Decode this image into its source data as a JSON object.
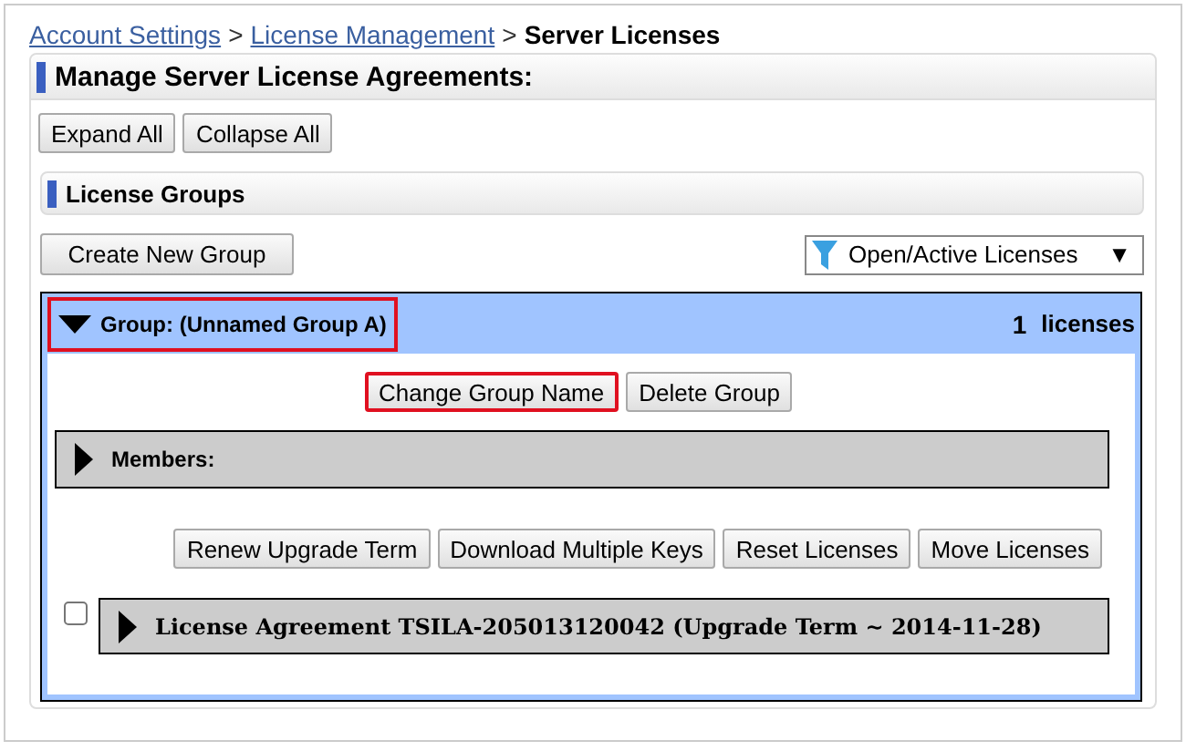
{
  "breadcrumb": {
    "links": [
      "Account Settings",
      "License Management"
    ],
    "separators": [
      ">",
      ">"
    ],
    "current": "Server Licenses"
  },
  "panel": {
    "title": "Manage Server License Agreements:",
    "buttons": [
      "Expand All",
      "Collapse All"
    ]
  },
  "license_groups": {
    "title": "License Groups",
    "create_button": "Create New Group",
    "filter": {
      "value": "Open/Active Licenses",
      "caret": "▼"
    },
    "groups": [
      {
        "name": "Group: (Unnamed Group A)",
        "expanded": true,
        "highlighted": true,
        "count": "1",
        "count_label": "licenses",
        "buttons": [
          {
            "label": "Change Group Name",
            "highlighted": true
          },
          {
            "label": "Delete Group",
            "highlighted": false
          }
        ],
        "members": {
          "label": "Members:",
          "expanded": false
        },
        "actions": [
          "Renew Upgrade Term",
          "Download Multiple Keys",
          "Reset Licenses",
          "Move Licenses"
        ],
        "licenses": [
          {
            "label": "License Agreement TSILA-205013120042 (Upgrade Term ~ 2014-11-28)",
            "checked": false,
            "expanded": false
          }
        ]
      }
    ]
  }
}
